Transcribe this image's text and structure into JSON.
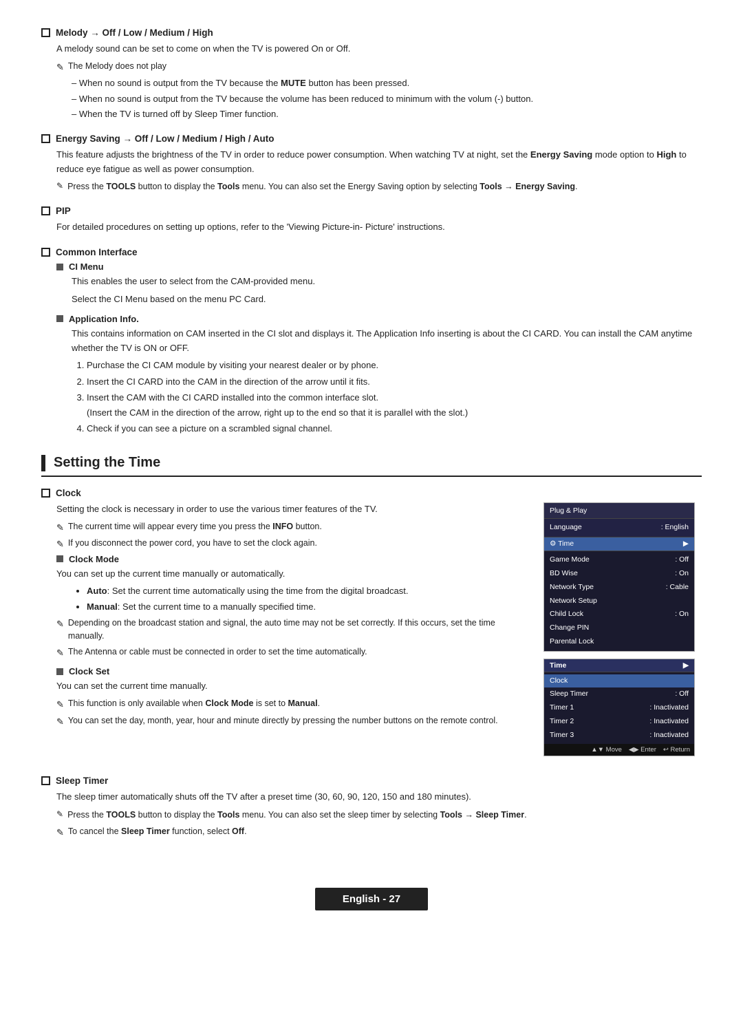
{
  "sections": {
    "melody": {
      "title": "Melody → Off / Low / Medium / High",
      "body": "A melody sound can be set to come on when the TV is powered On or Off.",
      "note1": "The Melody does not play",
      "dashes": [
        "When no sound is output from the TV because the MUTE button has been pressed.",
        "When no sound is output from the TV because the volume has been reduced to minimum with the volum (-) button.",
        "When the TV is turned off by Sleep Timer function."
      ]
    },
    "energy": {
      "title": "Energy Saving → Off / Low / Medium / High / Auto",
      "body": "This feature adjusts the brightness of the TV in order to reduce power consumption. When watching TV at night, set the Energy Saving mode option to High to reduce eye fatigue as well as power consumption.",
      "note": "Press the TOOLS button to display the Tools menu. You can also set the Energy Saving option by selecting Tools → Energy Saving."
    },
    "pip": {
      "title": "PIP",
      "body": "For detailed procedures on setting up options, refer to the 'Viewing Picture-in- Picture' instructions."
    },
    "common": {
      "title": "Common Interface",
      "ci_menu": {
        "title": "CI Menu",
        "body1": "This enables the user to select from the CAM-provided menu.",
        "body2": "Select the CI Menu based on the menu PC Card."
      },
      "app_info": {
        "title": "Application Info.",
        "body": "This contains information on CAM inserted in the CI slot and displays it. The Application Info inserting is about the CI CARD. You can install the CAM anytime whether the TV is ON or OFF.",
        "items": [
          "Purchase the CI CAM module by visiting your nearest dealer or by phone.",
          "Insert the CI CARD into the CAM in the direction of the arrow until it fits.",
          "Insert the CAM with the CI CARD installed into the common interface slot.",
          "(Insert the CAM in the direction of the arrow, right up to the end so that it is parallel with the slot.)",
          "Check if you can see a picture on a scrambled signal channel."
        ]
      }
    },
    "setting_time": {
      "header": "Setting the Time"
    },
    "clock": {
      "title": "Clock",
      "body": "Setting the clock is necessary in order to use the various timer features of the TV.",
      "note1": "The current time will appear every time you press the INFO button.",
      "note2": "If you disconnect the power cord, you have to set the clock again.",
      "clock_mode": {
        "title": "Clock Mode",
        "body": "You can set up the current time manually or automatically.",
        "auto": "Auto: Set the current time automatically using the time from the digital broadcast.",
        "manual": "Manual: Set the current time to a manually specified time.",
        "note1": "Depending on the broadcast station and signal, the auto time may not be set correctly. If this occurs, set the time manually.",
        "note2": "The Antenna or cable must be connected in order to set the time automatically."
      },
      "clock_set": {
        "title": "Clock Set",
        "body": "You can set the current time manually.",
        "note1": "This function is only available when Clock Mode is set to Manual.",
        "note2": "You can set the day, month, year, hour and minute directly by pressing the number buttons on the remote control."
      },
      "menu1": {
        "title": "Plug & Play",
        "lang_label": "Language",
        "lang_value": ": English",
        "time_label": "▶ Time",
        "rows": [
          {
            "label": "Game Mode",
            "value": ": Off"
          },
          {
            "label": "BD Wise",
            "value": ": On"
          },
          {
            "label": "Network Type",
            "value": ": Cable"
          },
          {
            "label": "Network Setup",
            "value": ""
          },
          {
            "label": "Child Lock",
            "value": ": On"
          },
          {
            "label": "Change PIN",
            "value": ""
          },
          {
            "label": "Parental Lock",
            "value": ""
          }
        ]
      },
      "menu2": {
        "title": "Time",
        "rows": [
          {
            "label": "Clock",
            "value": ""
          },
          {
            "label": "Sleep Timer",
            "value": ": Off"
          },
          {
            "label": "Timer 1",
            "value": ": Inactivated"
          },
          {
            "label": "Timer 2",
            "value": ": Inactivated"
          },
          {
            "label": "Timer 3",
            "value": ": Inactivated"
          }
        ],
        "bottom": "▲▼ Move   ◀▶ Enter   ↩ Return"
      }
    },
    "sleep_timer": {
      "title": "Sleep Timer",
      "body": "The sleep timer automatically shuts off the TV after a preset time (30, 60, 90, 120, 150 and 180 minutes).",
      "note1": "Press the TOOLS button to display the Tools menu. You can also set the sleep timer by selecting Tools → Sleep Timer.",
      "note2": "To cancel the Sleep Timer function, select Off."
    }
  },
  "footer": {
    "label": "English - 27"
  }
}
